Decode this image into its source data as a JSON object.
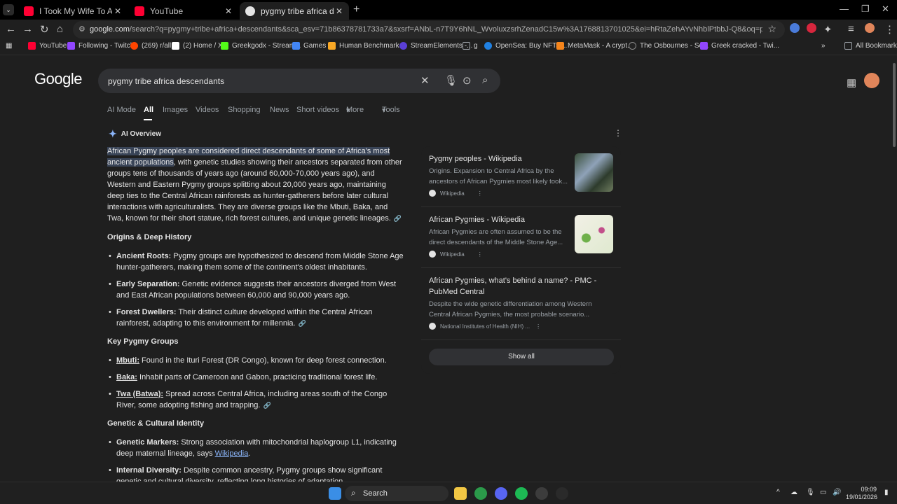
{
  "tabs": [
    {
      "title": "I Took My Wife To Africa's Most",
      "favicon_color": "#ff0033"
    },
    {
      "title": "YouTube",
      "favicon_color": "#ff0033"
    },
    {
      "title": "pygmy tribe africa descendants",
      "favicon_color": "#e3e3e3"
    }
  ],
  "toolbar": {
    "url_host": "google.com",
    "url_rest": "/search?q=pygmy+tribe+africa+descendants&sca_esv=71b86378781733a7&sxsrf=ANbL-n7T9Y6hNL_WvoluxzsrhZenadC15w%3A1768813701025&ei=hRtaZehAYvNhblPtbbJ-Q8&oq=pygmy+tribe+africa+dicend&gs_l..."
  },
  "bookmarks": [
    {
      "label": "YouTube",
      "color": "#ff0033"
    },
    {
      "label": "Following - Twitch",
      "color": "#9146ff"
    },
    {
      "label": "(269) r/all",
      "color": "#ff4500"
    },
    {
      "label": "(2) Home / X",
      "color": "#ffffff"
    },
    {
      "label": "Greekgodx - Stream...",
      "color": "#53fc18"
    },
    {
      "label": "Games",
      "color": "#4285f4"
    },
    {
      "label": "Human Benchmark...",
      "color": "#f9a825"
    },
    {
      "label": "StreamElements -...",
      "color": "#5a3fd6"
    },
    {
      "label": "g",
      "color": "#9aa0a6"
    },
    {
      "label": "OpenSea: Buy NFTs,...",
      "color": "#2081e2"
    },
    {
      "label": "MetaMask - A crypt...",
      "color": "#f6851b"
    },
    {
      "label": "The Osbournes - Se...",
      "color": "#222222"
    },
    {
      "label": "Greek cracked - Twi...",
      "color": "#9146ff"
    },
    {
      "label": "All Bookmarks",
      "color": "#9aa0a6"
    }
  ],
  "google": {
    "logo": "Google",
    "query": "pygmy tribe africa descendants",
    "search_tabs": [
      "AI Mode",
      "All",
      "Images",
      "Videos",
      "Shopping",
      "News",
      "Short videos",
      "More",
      "Tools"
    ]
  },
  "ai_overview": {
    "header": "AI Overview",
    "intro_highlight": "African Pygmy peoples are considered direct descendants of some of Africa's most ancient populations",
    "intro_rest": ", with genetic studies showing their ancestors separated from other groups tens of thousands of years ago (around 60,000-70,000 years ago), and Western and Eastern Pygmy groups splitting about 20,000 years ago, maintaining deep ties to the Central African rainforests as hunter-gatherers before later cultural interactions with agriculturalists. They are diverse groups like the Mbuti, Baka, and Twa, known for their short stature, rich forest cultures, and unique genetic lineages.",
    "sections": [
      {
        "heading": "Origins & Deep History",
        "items": [
          {
            "term": "Ancient Roots:",
            "text": " Pygmy groups are hypothesized to descend from Middle Stone Age hunter-gatherers, making them some of the continent's oldest inhabitants."
          },
          {
            "term": "Early Separation:",
            "text": " Genetic evidence suggests their ancestors diverged from West and East African populations between 60,000 and 90,000 years ago."
          },
          {
            "term": "Forest Dwellers:",
            "text": " Their distinct culture developed within the Central African rainforest, adapting to this environment for millennia."
          }
        ]
      },
      {
        "heading": "Key Pygmy Groups",
        "items": [
          {
            "term": "Mbuti:",
            "text": " Found in the Ituri Forest (DR Congo), known for deep forest connection."
          },
          {
            "term": "Baka:",
            "text": " Inhabit parts of Cameroon and Gabon, practicing traditional forest life."
          },
          {
            "term": "Twa (Batwa):",
            "text": " Spread across Central Africa, including areas south of the Congo River, some adopting fishing and trapping."
          }
        ]
      },
      {
        "heading": "Genetic & Cultural Identity",
        "items": [
          {
            "term": "Genetic Markers:",
            "text": " Strong association with mitochondrial haplogroup L1, indicating deep maternal lineage, says ",
            "link": "Wikipedia",
            "after": "."
          },
          {
            "term": "Internal Diversity:",
            "text": " Despite common ancestry, Pygmy groups show significant genetic and cultural diversity, reflecting long histories of adaptation."
          }
        ]
      }
    ]
  },
  "sources": [
    {
      "title": "Pygmy peoples - Wikipedia",
      "desc": "Origins. Expansion to Central Africa by the ancestors of African Pygmies most likely took...",
      "site": "Wikipedia"
    },
    {
      "title": "African Pygmies - Wikipedia",
      "desc": "African Pygmies are often assumed to be the direct descendants of the Middle Stone Age...",
      "site": "Wikipedia"
    },
    {
      "title": "African Pygmies, what's behind a name? - PMC - PubMed Central",
      "desc": "Despite the wide genetic differentiation among Western Central African Pygmies, the most probable scenario...",
      "site": "National Institutes of Health (NIH) ..."
    }
  ],
  "show_all": "Show all",
  "taskbar": {
    "search": "Search",
    "time": "09:09",
    "date": "19/01/2026"
  }
}
